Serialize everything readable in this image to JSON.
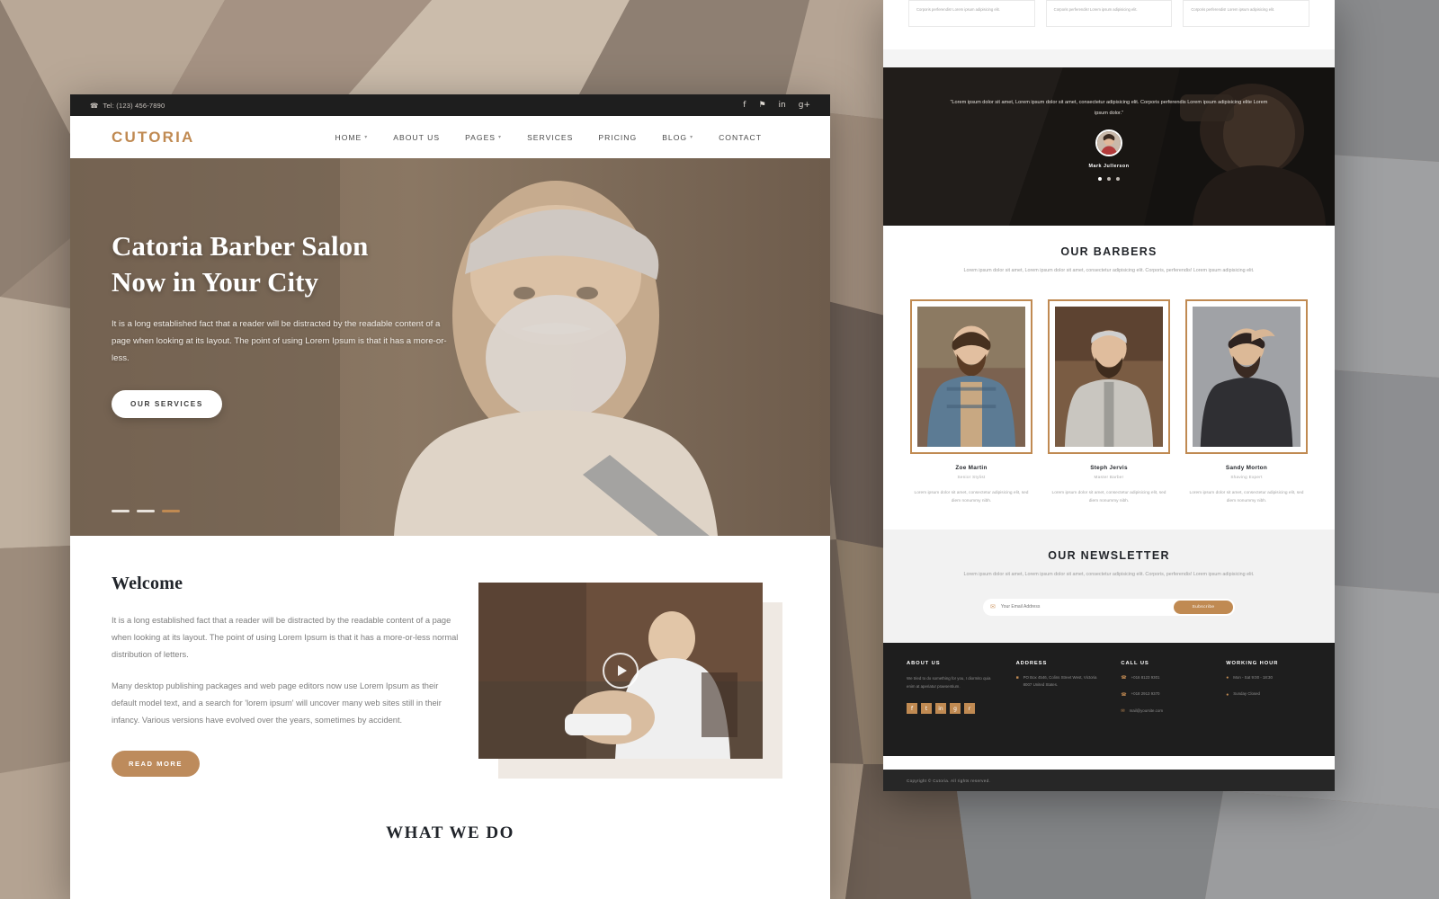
{
  "colors": {
    "accent": "#c08a52",
    "dark": "#1e1e1e",
    "tan_button": "#bd8b5c"
  },
  "left_page": {
    "topbar": {
      "phone": "Tel: (123) 456-7890",
      "phone_icon": "phone-icon",
      "social": [
        {
          "name": "facebook-icon",
          "glyph": "f"
        },
        {
          "name": "twitter-icon",
          "glyph": "⚑"
        },
        {
          "name": "linkedin-icon",
          "glyph": "in"
        },
        {
          "name": "google-plus-icon",
          "glyph": "g+"
        }
      ]
    },
    "navbar": {
      "brand": "CUTORIA",
      "items": [
        {
          "label": "HOME",
          "caret": "▾"
        },
        {
          "label": "ABOUT US",
          "caret": ""
        },
        {
          "label": "PAGES",
          "caret": "▾"
        },
        {
          "label": "SERVICES",
          "caret": ""
        },
        {
          "label": "PRICING",
          "caret": ""
        },
        {
          "label": "BLOG",
          "caret": "▾"
        },
        {
          "label": "CONTACT",
          "caret": ""
        }
      ]
    },
    "hero": {
      "title_line1": "Catoria Barber Salon",
      "title_line2": "Now in Your City",
      "paragraph": "It is a long established fact that a reader will be distracted by the readable content of a page when looking at its layout. The point of using Lorem Ipsum is that it has a more-or-less.",
      "cta": "OUR SERVICES",
      "slide_count": 3,
      "active_slide": 3
    },
    "welcome": {
      "heading": "Welcome",
      "paragraph1": "It is a long established fact that a reader will be distracted by the readable content of a page when looking at its layout. The point of using Lorem Ipsum is that it has a more-or-less normal distribution of letters.",
      "paragraph2": "Many desktop publishing packages and web page editors now use Lorem Ipsum as their default model text, and a search for 'lorem ipsum' will uncover many web sites still in their infancy. Various versions have evolved over the years, sometimes by accident.",
      "cta": "READ MORE",
      "video_play_icon": "play-icon"
    },
    "what_we_do_heading": "WHAT WE DO"
  },
  "right_page": {
    "mini_cards": [
      {
        "text": "Corporis perferendis! Lorem ipsum adipisicing elit."
      },
      {
        "text": "Corporis perferendis! Lorem ipsum adipisicing elit."
      },
      {
        "text": "Corporis perferendis! Lorem ipsum adipisicing elit."
      }
    ],
    "testimonial": {
      "quote": "“Lorem ipsum dolor sit amet, Lorem ipsum dolor sit amet, consectetur adipisicing elit. Corporis perferendis Lorem ipsum adipisicing elite Lorem ipsum dolor.”",
      "name": "Mark Jullerson",
      "dot_count": 3,
      "active_dot": 1
    },
    "barbers_section": {
      "title": "OUR BARBERS",
      "subtitle": "Lorem ipsum dolor sit amet, Lorem ipsum dolor sit amet, consectetur adipisicing elit. Corporis, perferendis! Lorem ipsum adipisicing elit.",
      "members": [
        {
          "name": "Zoe Martin",
          "role": "Senior Stylist",
          "desc": "Lorem ipsum dolor sit amet, consectetur adipisicing elit, sed diem nonummy nibh."
        },
        {
          "name": "Steph Jervis",
          "role": "Master Barber",
          "desc": "Lorem ipsum dolor sit amet, consectetur adipisicing elit, sed diem nonummy nibh."
        },
        {
          "name": "Sandy Morton",
          "role": "Shaving Expert",
          "desc": "Lorem ipsum dolor sit amet, consectetur adipisicing elit, sed diem nonummy nibh."
        }
      ]
    },
    "newsletter": {
      "title": "OUR NEWSLETTER",
      "subtitle": "Lorem ipsum dolor sit amet, Lorem ipsum dolor sit amet, consectetur adipisicing elit. Corporis, perferendis! Lorem ipsum adipisicing elit.",
      "email_icon": "envelope-icon",
      "email_placeholder": "Your Email Address",
      "email_value": "",
      "submit_label": "Subscribe"
    },
    "footer": {
      "about": {
        "heading": "ABOUT US",
        "text": "We tried to do something for you, I diormito quia enim at aperiatur praesentium."
      },
      "address": {
        "heading": "ADDRESS",
        "icon": "location-icon",
        "lines": "PO Box 4546, Colins Street West, Victoria 8007 United States."
      },
      "call": {
        "heading": "CALL US",
        "items": [
          {
            "icon": "phone-icon",
            "text": "+016 8123 9301"
          },
          {
            "icon": "phone-icon",
            "text": "+018 2913 9370"
          },
          {
            "icon": "envelope-icon",
            "text": "mail@yoursite.com"
          }
        ]
      },
      "hours": {
        "heading": "WORKING HOUR",
        "items": [
          {
            "icon": "clock-icon",
            "text": "Mon - Sat 9:00 - 18:30"
          },
          {
            "icon": "clock-icon",
            "text": "Sunday Closed"
          }
        ]
      },
      "social": [
        {
          "name": "facebook-icon",
          "glyph": "f"
        },
        {
          "name": "twitter-icon",
          "glyph": "t"
        },
        {
          "name": "linkedin-icon",
          "glyph": "in"
        },
        {
          "name": "google-plus-icon",
          "glyph": "g"
        },
        {
          "name": "rss-icon",
          "glyph": "r"
        }
      ],
      "copyright": "Copyright © Cutoria. All rights reserved."
    }
  }
}
